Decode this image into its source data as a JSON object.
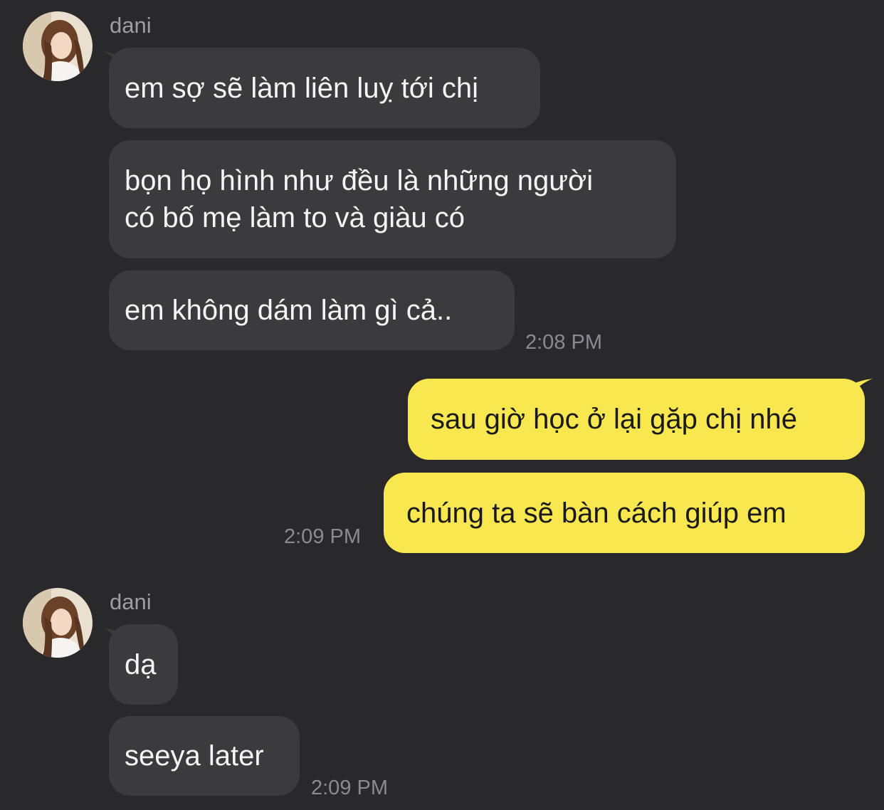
{
  "colors": {
    "background": "#29292b",
    "incoming_bubble": "#3b3b3e",
    "outgoing_bubble": "#f9e74f",
    "sender_name": "#9d9da3",
    "timestamp": "#8a8a90"
  },
  "groups": [
    {
      "sender": "dani",
      "avatar_icon": "profile-photo-avatar",
      "messages": [
        "em sợ sẽ làm liên luỵ tới chị",
        "bọn họ hình như đều là những người\ncó bố mẹ làm to và giàu có",
        "em không dám làm gì cả.."
      ],
      "time": "2:08 PM"
    },
    {
      "sender": "me",
      "messages": [
        "sau giờ học ở lại gặp chị nhé",
        "chúng ta sẽ bàn cách giúp em"
      ],
      "time": "2:09 PM"
    },
    {
      "sender": "dani",
      "avatar_icon": "profile-photo-avatar",
      "messages": [
        "dạ",
        "seeya later"
      ],
      "time": "2:09 PM"
    }
  ]
}
